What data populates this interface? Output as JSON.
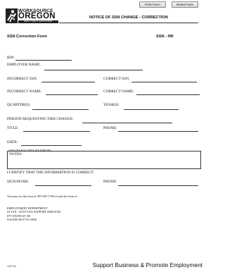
{
  "buttons": {
    "print": "Print Form",
    "reset": "Reset Form"
  },
  "logo": {
    "line1": "WORKSOURCE",
    "line2": "OREGON",
    "line3": "EMPLOYMENT DEPARTMENT"
  },
  "header": {
    "title": "NOTICE OF SSN CHANGE - CORRECTION"
  },
  "subheader": {
    "left": "SSN Correction Form",
    "right": "SSN - HR"
  },
  "fields": {
    "bin": "BIN:",
    "employer_name": "EMPLOYER NAME:",
    "incorrect_ssn": "INCORRECT SSN:",
    "correct_ssn": "CORRECT SSN:",
    "incorrect_name": "INCORRECT NAME:",
    "correct_name": "CORRECT NAME:",
    "quarters": "QUARTER(S):",
    "years": "YEAR(S):",
    "person_requesting": "PERSON REQUESTING THIS CHANGE:",
    "title": "TITLE:",
    "phone": "PHONE:",
    "date": "DATE:",
    "notes_limit": "(300  CHARACTERS  MAXIMUM)",
    "notes": "NOTES:",
    "certify": "I CERTIFY THAT THE INFORMATION IS CORRECT:",
    "signature": "SIGNATURE:",
    "phone2": "PHONE:"
  },
  "fax_note": "You may fax this form to 503-947-1700 or mail the form to:",
  "address": [
    "EMPLOYMENT DEPARTMENT",
    "UI TAX - ATTN TAX SUPPORT SERVICES",
    "875 UNION ST NE",
    "SALEM OR  97311-0030"
  ],
  "footer": {
    "form_number": "126P7(0)",
    "tagline": "Support Business & Promote Employment"
  }
}
